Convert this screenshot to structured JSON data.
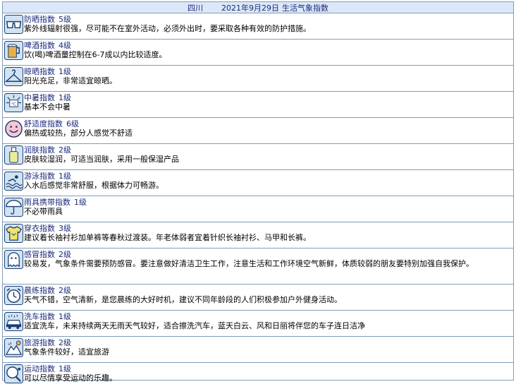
{
  "header": {
    "region": "四川",
    "date": "2021年9月29日",
    "title": "生活气象指数"
  },
  "colors": {
    "border": "#7f9db9",
    "header_bg": "#dce8f7",
    "title_text": "#1b2a7a",
    "icon_bg": "#cfe3f3",
    "icon_line": "#1c3c6e"
  },
  "rows": [
    {
      "icon": "sunglasses-icon",
      "name": "防晒指数",
      "level": "5级",
      "desc": "紫外线辐射很强，尽可能不在室外活动，必须外出时，要采取各种有效的防护措施。"
    },
    {
      "icon": "beer-mug-icon",
      "name": "啤酒指数",
      "level": "4级",
      "desc": "饮(喝)啤酒量控制在6-7成以内比较适度。"
    },
    {
      "icon": "clothes-hanger-icon",
      "name": "晾晒指数",
      "level": "1级",
      "desc": "阳光充足，非常适宜晾晒。"
    },
    {
      "icon": "thermometer-sun-icon",
      "name": "中暑指数",
      "level": "1级",
      "desc": "基本不会中暑"
    },
    {
      "icon": "smiley-face-icon",
      "name": "舒适度指数",
      "level": "6级",
      "desc": "偏热或较热，部分人感觉不舒适"
    },
    {
      "icon": "lotion-bottle-icon",
      "name": "润肤指数",
      "level": "2级",
      "desc": "皮肤较湿润，可适当润肤，采用一般保湿产品"
    },
    {
      "icon": "swimming-icon",
      "name": "游泳指数",
      "level": "1级",
      "desc": "入水后感觉非常舒服，根据体力可畅游。"
    },
    {
      "icon": "umbrella-icon",
      "name": "雨具携带指数",
      "level": "1级",
      "desc": "不必带雨具"
    },
    {
      "icon": "tshirt-icon",
      "name": "穿衣指数",
      "level": "3级",
      "desc": "建议着长袖衬衫加单裤等春秋过渡装。年老体弱者宜着针织长袖衬衫、马甲和长裤。"
    },
    {
      "icon": "ghost-icon",
      "name": "感冒指数",
      "level": "2级",
      "desc": "较易发，气象条件需要预防感冒。要注意做好清洁卫生工作，注意生活和工作环境空气新鲜，体质较弱的朋友要特别加强自我保护。"
    },
    {
      "icon": "alarm-clock-icon",
      "name": "晨练指数",
      "level": "2级",
      "desc": "天气不错，空气清新，是您晨练的大好时机，建议不同年龄段的人们积极参加户外健身活动。"
    },
    {
      "icon": "car-wash-icon",
      "name": "洗车指数",
      "level": "1级",
      "desc": "适宜洗车，未来持续两天无雨天气较好，适合擦洗汽车，蓝天白云、风和日丽将伴您的车子连日洁净"
    },
    {
      "icon": "mountain-travel-icon",
      "name": "旅游指数",
      "level": "2级",
      "desc": "气象条件较好，适宜旅游"
    },
    {
      "icon": "ping-pong-paddle-icon",
      "name": "运动指数",
      "level": "1级",
      "desc": "可以尽情享受运动的乐趣。"
    }
  ]
}
